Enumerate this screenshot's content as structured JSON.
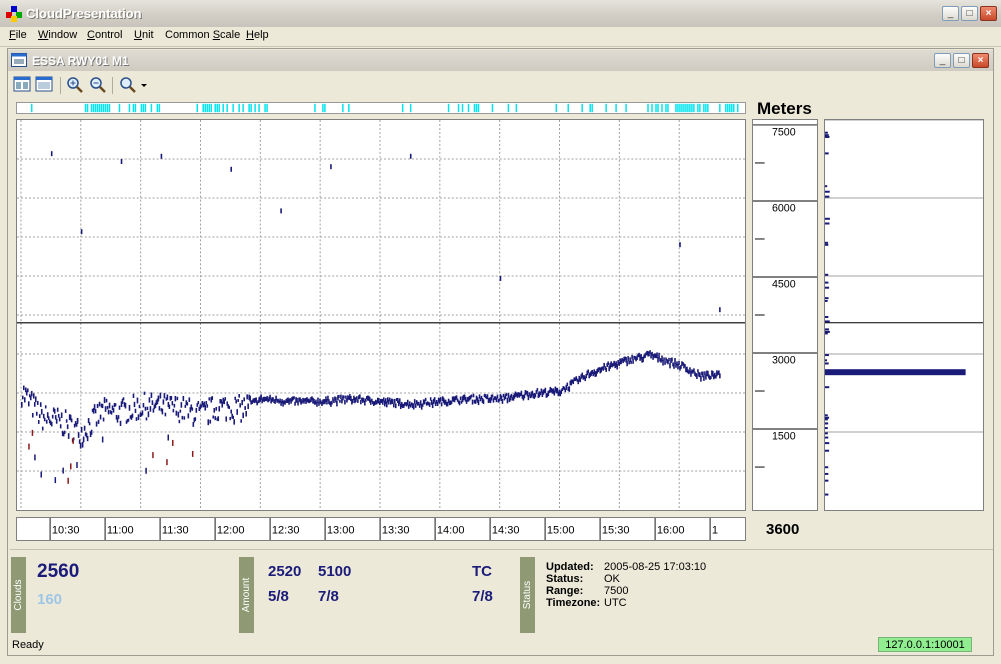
{
  "app": {
    "title": "CloudPresentation"
  },
  "menu": {
    "file": "File",
    "file_key": "F",
    "window": "Window",
    "window_key": "W",
    "control": "Control",
    "control_key": "C",
    "unit": "Unit",
    "unit_key": "U",
    "common_scale": "Common Scale",
    "common_scale_key": "S",
    "help": "Help",
    "help_key": "H"
  },
  "child_window": {
    "title": "ESSA RWY01 M1"
  },
  "toolbar": {
    "icons": [
      "window-icon",
      "window-icon",
      "zoom-in-icon",
      "zoom-out-icon",
      "zoom-dropdown-icon"
    ]
  },
  "chart_data": {
    "type": "scatter",
    "title": "",
    "xlabel": "",
    "ylabel": "Meters",
    "x_ticks": [
      "10:30",
      "11:00",
      "11:30",
      "12:00",
      "12:30",
      "13:00",
      "13:30",
      "14:00",
      "14:30",
      "15:00",
      "15:30",
      "16:00",
      "1"
    ],
    "y_ticks": [
      "7500",
      "6000",
      "4500",
      "3000",
      "1500"
    ],
    "ylim": [
      0,
      7500
    ],
    "threshold_line_m": 3600,
    "grid": true,
    "series": [
      {
        "color": "#1a1a78",
        "x": [
          "10:30",
          "10:40",
          "10:50",
          "11:00",
          "11:10",
          "11:20",
          "11:30",
          "11:40",
          "11:50",
          "12:00",
          "12:10",
          "12:20",
          "12:30",
          "12:45",
          "13:00",
          "13:15",
          "13:30",
          "13:45",
          "14:00",
          "14:15",
          "14:30",
          "14:45",
          "15:00",
          "15:15",
          "15:30",
          "15:45",
          "16:00",
          "16:10",
          "16:20"
        ],
        "y": [
          2300,
          1800,
          1700,
          1500,
          1900,
          1900,
          2000,
          2000,
          1950,
          1850,
          2000,
          1950,
          2150,
          2100,
          2100,
          2150,
          2100,
          2050,
          2100,
          2150,
          2150,
          2250,
          2300,
          2650,
          2850,
          3000,
          2800,
          2600,
          2600
        ]
      }
    ],
    "scatter_high": {
      "x": [
        "10:45",
        "11:00",
        "11:20",
        "11:40",
        "12:15",
        "12:40",
        "13:05",
        "13:45",
        "14:30",
        "16:00",
        "16:20"
      ],
      "y": [
        6900,
        5400,
        6750,
        6850,
        6600,
        5800,
        6650,
        6850,
        4500,
        5150,
        3900
      ]
    }
  },
  "side_panel": {
    "units": "Meters",
    "current_value": "3600",
    "histogram": {
      "level_m": 2650,
      "share": 0.89
    }
  },
  "clouds": {
    "label": "Clouds",
    "value": "2560",
    "secondary": "160"
  },
  "amount": {
    "label": "Amount",
    "col1_height": "2520",
    "col1_amount": "5/8",
    "col2_height": "5100",
    "col2_amount": "7/8",
    "col3_height": "TC",
    "col3_amount": "7/8"
  },
  "status": {
    "label": "Status",
    "updated_label": "Updated:",
    "updated_value": "2005-08-25 17:03:10",
    "status_label": "Status:",
    "status_value": "OK",
    "range_label": "Range:",
    "range_value": "7500",
    "timezone_label": "Timezone:",
    "timezone_value": "UTC"
  },
  "statusbar": {
    "ready": "Ready",
    "connection": "127.0.0.1:10001"
  }
}
